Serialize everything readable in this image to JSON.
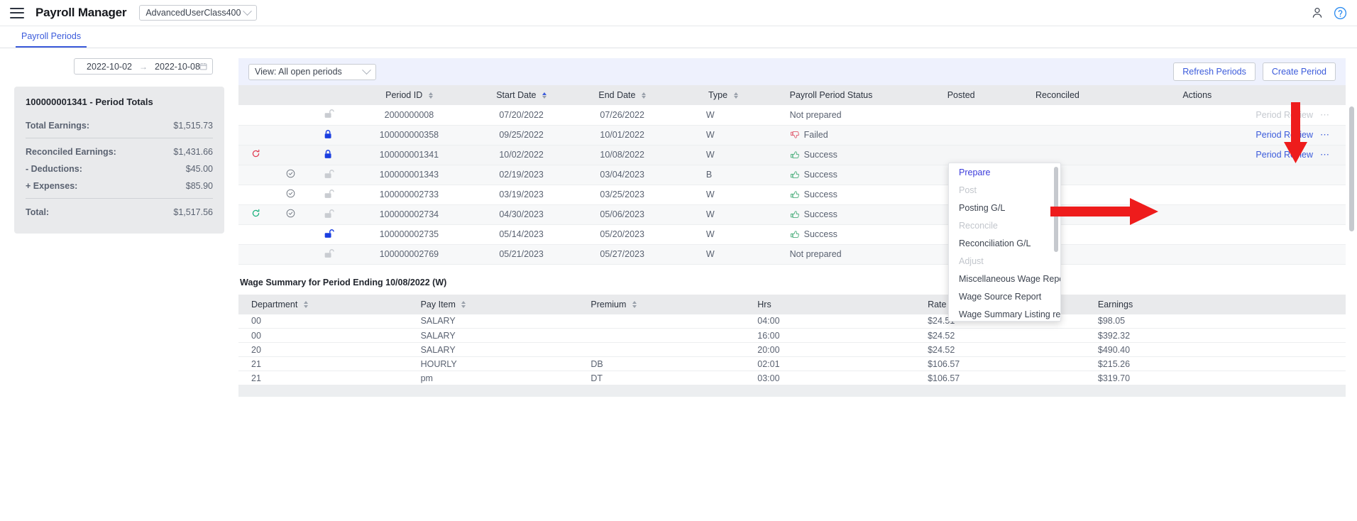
{
  "header": {
    "menu_icon": "hamburger-icon",
    "title": "Payroll Manager",
    "user_class": "AdvancedUserClass400",
    "person_icon": "person-icon",
    "help_icon": "help-circle-icon"
  },
  "tabs": [
    {
      "label": "Payroll Periods",
      "active": true
    }
  ],
  "left": {
    "date_range": {
      "start": "2022-10-02",
      "sep": "→",
      "end": "2022-10-08",
      "calendar_icon": "calendar-icon"
    },
    "totals": {
      "title": "100000001341 - Period Totals",
      "rows": [
        {
          "label": "Total Earnings:",
          "value": "$1,515.73"
        },
        {
          "label": "Reconciled Earnings:",
          "value": "$1,431.66"
        },
        {
          "label": "- Deductions:",
          "value": "$45.00"
        },
        {
          "label": "+ Expenses:",
          "value": "$85.90"
        },
        {
          "label": "Total:",
          "value": "$1,517.56"
        }
      ]
    }
  },
  "toolbar": {
    "view_select": "View: All open periods",
    "refresh_label": "Refresh Periods",
    "create_label": "Create Period"
  },
  "periods_table": {
    "columns": [
      "",
      "",
      "",
      "Period ID",
      "Start Date",
      "End Date",
      "Type",
      "Payroll Period Status",
      "Posted",
      "Reconciled",
      "Actions"
    ],
    "rows": [
      {
        "retry": "",
        "check": "",
        "lock": "open-grey",
        "id": "2000000008",
        "start": "07/20/2022",
        "end": "07/26/2022",
        "type": "W",
        "status": "Not prepared",
        "status_icon": "",
        "posted": "",
        "reconciled": "",
        "action": "Period Review",
        "action_disabled": true
      },
      {
        "retry": "",
        "check": "",
        "lock": "closed-blue",
        "id": "100000000358",
        "start": "09/25/2022",
        "end": "10/01/2022",
        "type": "W",
        "status": "Failed",
        "status_icon": "thumbs-down-icon",
        "posted": "",
        "reconciled": "",
        "action": "Period Review",
        "action_disabled": false
      },
      {
        "retry": "red",
        "check": "",
        "lock": "closed-blue",
        "id": "100000001341",
        "start": "10/02/2022",
        "end": "10/08/2022",
        "type": "W",
        "status": "Success",
        "status_icon": "thumbs-up-icon",
        "posted": "",
        "reconciled": "",
        "action": "Period Review",
        "action_disabled": false
      },
      {
        "retry": "",
        "check": "yes",
        "lock": "open-grey",
        "id": "100000001343",
        "start": "02/19/2023",
        "end": "03/04/2023",
        "type": "B",
        "status": "Success",
        "status_icon": "thumbs-up-icon",
        "posted": "",
        "reconciled": "",
        "action": "",
        "action_disabled": false
      },
      {
        "retry": "",
        "check": "yes",
        "lock": "open-grey",
        "id": "100000002733",
        "start": "03/19/2023",
        "end": "03/25/2023",
        "type": "W",
        "status": "Success",
        "status_icon": "thumbs-up-icon",
        "posted": "",
        "reconciled": "",
        "action": "",
        "action_disabled": false
      },
      {
        "retry": "green",
        "check": "yes",
        "lock": "open-grey",
        "id": "100000002734",
        "start": "04/30/2023",
        "end": "05/06/2023",
        "type": "W",
        "status": "Success",
        "status_icon": "thumbs-up-icon",
        "posted": "✓",
        "reconciled": "",
        "action": "",
        "action_disabled": false
      },
      {
        "retry": "",
        "check": "",
        "lock": "open-blue",
        "id": "100000002735",
        "start": "05/14/2023",
        "end": "05/20/2023",
        "type": "W",
        "status": "Success",
        "status_icon": "thumbs-up-icon",
        "posted": "",
        "reconciled": "",
        "action": "",
        "action_disabled": false
      },
      {
        "retry": "",
        "check": "",
        "lock": "open-grey",
        "id": "100000002769",
        "start": "05/21/2023",
        "end": "05/27/2023",
        "type": "W",
        "status": "Not prepared",
        "status_icon": "",
        "posted": "",
        "reconciled": "",
        "action": "",
        "action_disabled": false
      }
    ]
  },
  "wage_summary": {
    "title": "Wage Summary for Period Ending 10/08/2022 (W)",
    "columns": [
      "Department",
      "Pay Item",
      "Premium",
      "Hrs",
      "Rate",
      "Earnings"
    ],
    "rows": [
      {
        "dept": "00",
        "pay_item": "SALARY",
        "premium": "",
        "hrs": "04:00",
        "rate": "$24.51",
        "earnings": "$98.05"
      },
      {
        "dept": "00",
        "pay_item": "SALARY",
        "premium": "",
        "hrs": "16:00",
        "rate": "$24.52",
        "earnings": "$392.32"
      },
      {
        "dept": "20",
        "pay_item": "SALARY",
        "premium": "",
        "hrs": "20:00",
        "rate": "$24.52",
        "earnings": "$490.40"
      },
      {
        "dept": "21",
        "pay_item": "HOURLY",
        "premium": "DB",
        "hrs": "02:01",
        "rate": "$106.57",
        "earnings": "$215.26"
      },
      {
        "dept": "21",
        "pay_item": "pm",
        "premium": "DT",
        "hrs": "03:00",
        "rate": "$106.57",
        "earnings": "$319.70"
      }
    ]
  },
  "actions_menu": {
    "items": [
      {
        "label": "Prepare",
        "state": "active"
      },
      {
        "label": "Post",
        "state": "disabled"
      },
      {
        "label": "Posting G/L",
        "state": "normal"
      },
      {
        "label": "Reconcile",
        "state": "disabled"
      },
      {
        "label": "Reconciliation G/L",
        "state": "normal"
      },
      {
        "label": "Adjust",
        "state": "disabled"
      },
      {
        "label": "Miscellaneous Wage Report",
        "state": "normal"
      },
      {
        "label": "Wage Source Report",
        "state": "normal"
      },
      {
        "label": "Wage Summary Listing report",
        "state": "normal"
      }
    ]
  },
  "annotations": {
    "down_arrow": "red-down-arrow",
    "right_arrow": "red-right-arrow"
  },
  "colors": {
    "accent": "#3b5bdb",
    "success": "#4caf7d",
    "failure": "#e05c6e",
    "annotation": "#ee1c1c",
    "header_bg": "#e9eaec",
    "toolbar_bg": "#eef1fd"
  }
}
